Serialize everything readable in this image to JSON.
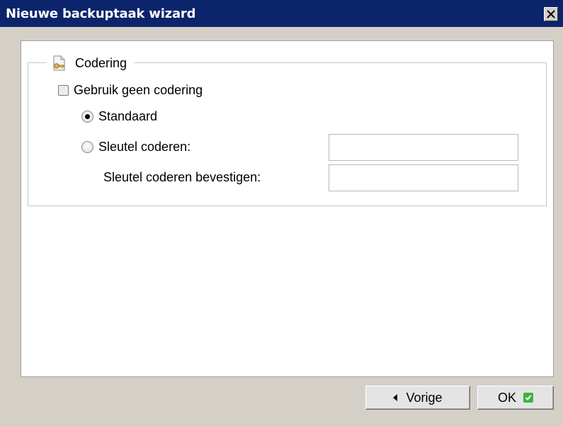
{
  "window": {
    "title": "Nieuwe backuptaak wizard",
    "close_icon": "close-icon"
  },
  "section": {
    "legend": "Codering",
    "icon": "key-document-icon"
  },
  "options": {
    "no_encryption_label": "Gebruik geen codering",
    "no_encryption_checked": false,
    "standard_label": "Standaard",
    "standard_selected": true,
    "key_label": "Sleutel coderen:",
    "key_selected": false,
    "key_value": "",
    "confirm_label": "Sleutel coderen bevestigen:",
    "confirm_value": ""
  },
  "buttons": {
    "back_label": "Vorige",
    "ok_label": "OK"
  },
  "colors": {
    "titlebar": "#0b246b",
    "ok_check": "#3bb53b",
    "window_bg": "#d4d0c8"
  }
}
